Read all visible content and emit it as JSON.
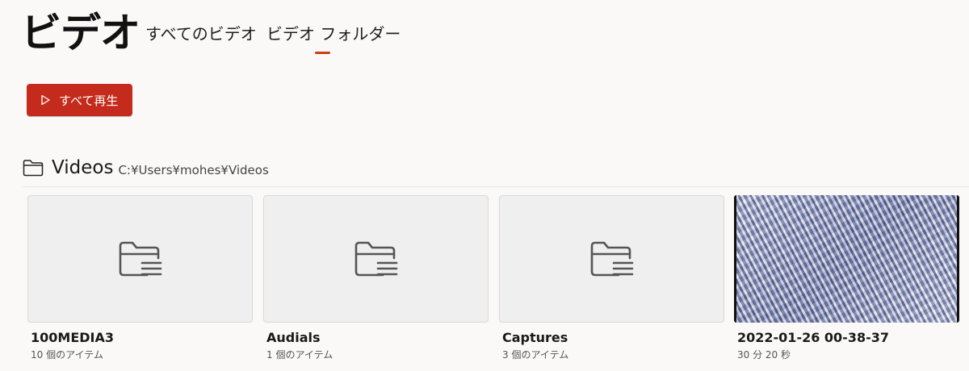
{
  "header": {
    "title": "ビデオ",
    "tabs": [
      {
        "label": "すべてのビデオ",
        "selected": false
      },
      {
        "label": "ビデオ フォルダー",
        "selected": true
      }
    ],
    "accent_color": "#c42b1c"
  },
  "actions": {
    "play_all_label": "すべて再生",
    "play_icon": "play-outline-icon"
  },
  "section": {
    "title": "Videos",
    "path": "C:¥Users¥mohes¥Videos",
    "icon": "folder-icon"
  },
  "items": [
    {
      "name": "100MEDIA3",
      "meta": "10 個のアイテム",
      "type": "folder"
    },
    {
      "name": "Audials",
      "meta": "1 個のアイテム",
      "type": "folder"
    },
    {
      "name": "Captures",
      "meta": "3 個のアイテム",
      "type": "folder"
    },
    {
      "name": "2022-01-26 00-38-37",
      "meta": "30 分 20 秒",
      "type": "video"
    }
  ]
}
